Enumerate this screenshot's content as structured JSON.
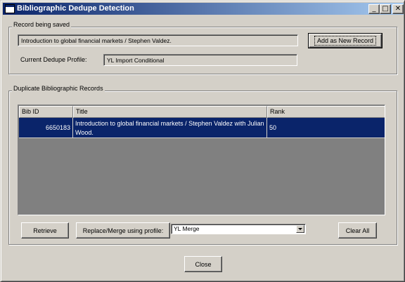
{
  "window": {
    "title": "Bibliographic Dedupe Detection",
    "minimize_glyph": "_",
    "maximize_glyph": "□",
    "close_glyph": "✕"
  },
  "record_group": {
    "label": "Record being saved",
    "record_text": "Introduction to global financial markets / Stephen Valdez.",
    "add_button": "Add as New Record",
    "profile_label": "Current Dedupe Profile:",
    "profile_value": "YL Import Conditional"
  },
  "duplicates_group": {
    "label": "Duplicate Bibliographic Records",
    "columns": [
      "Bib ID",
      "Title",
      "Rank"
    ],
    "rows": [
      {
        "bib_id": "6650183",
        "title": "Introduction to global financial markets / Stephen Valdez with Julian Wood.",
        "rank": "50",
        "selected": true
      }
    ],
    "retrieve_button": "Retrieve",
    "replace_button": "Replace/Merge using profile:",
    "merge_profile": "YL Merge",
    "clear_button": "Clear All"
  },
  "close_button": "Close",
  "colors": {
    "face": "#d4d0c8",
    "selection": "#0a246a",
    "title_gradient_start": "#0a246a",
    "title_gradient_end": "#a6caf0",
    "grid_empty": "#808080"
  },
  "icons": {
    "app_icon": "window-app-icon",
    "dropdown": "chevron-down-icon"
  }
}
